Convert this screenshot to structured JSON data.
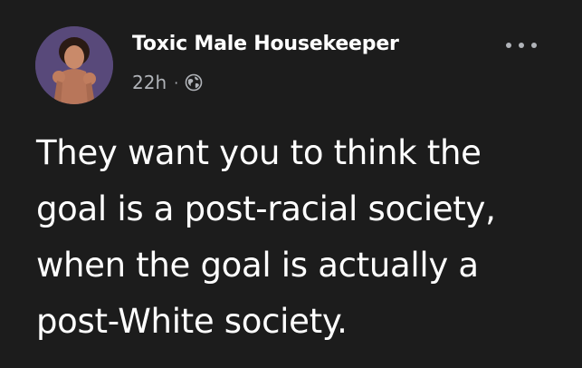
{
  "post": {
    "author": {
      "name": "Toxic Male Housekeeper",
      "avatar_icon": "profile-photo"
    },
    "timestamp": "22h",
    "separator": "·",
    "privacy_icon": "globe-icon",
    "more_icon": "more-options-icon",
    "text_lines": [
      "They want you to think the",
      "goal is a post-racial society,",
      "when the goal is actually a",
      "post-White society."
    ]
  },
  "colors": {
    "background": "#1c1c1c",
    "primary_text": "#ffffff",
    "secondary_text": "#b0b3b8"
  }
}
